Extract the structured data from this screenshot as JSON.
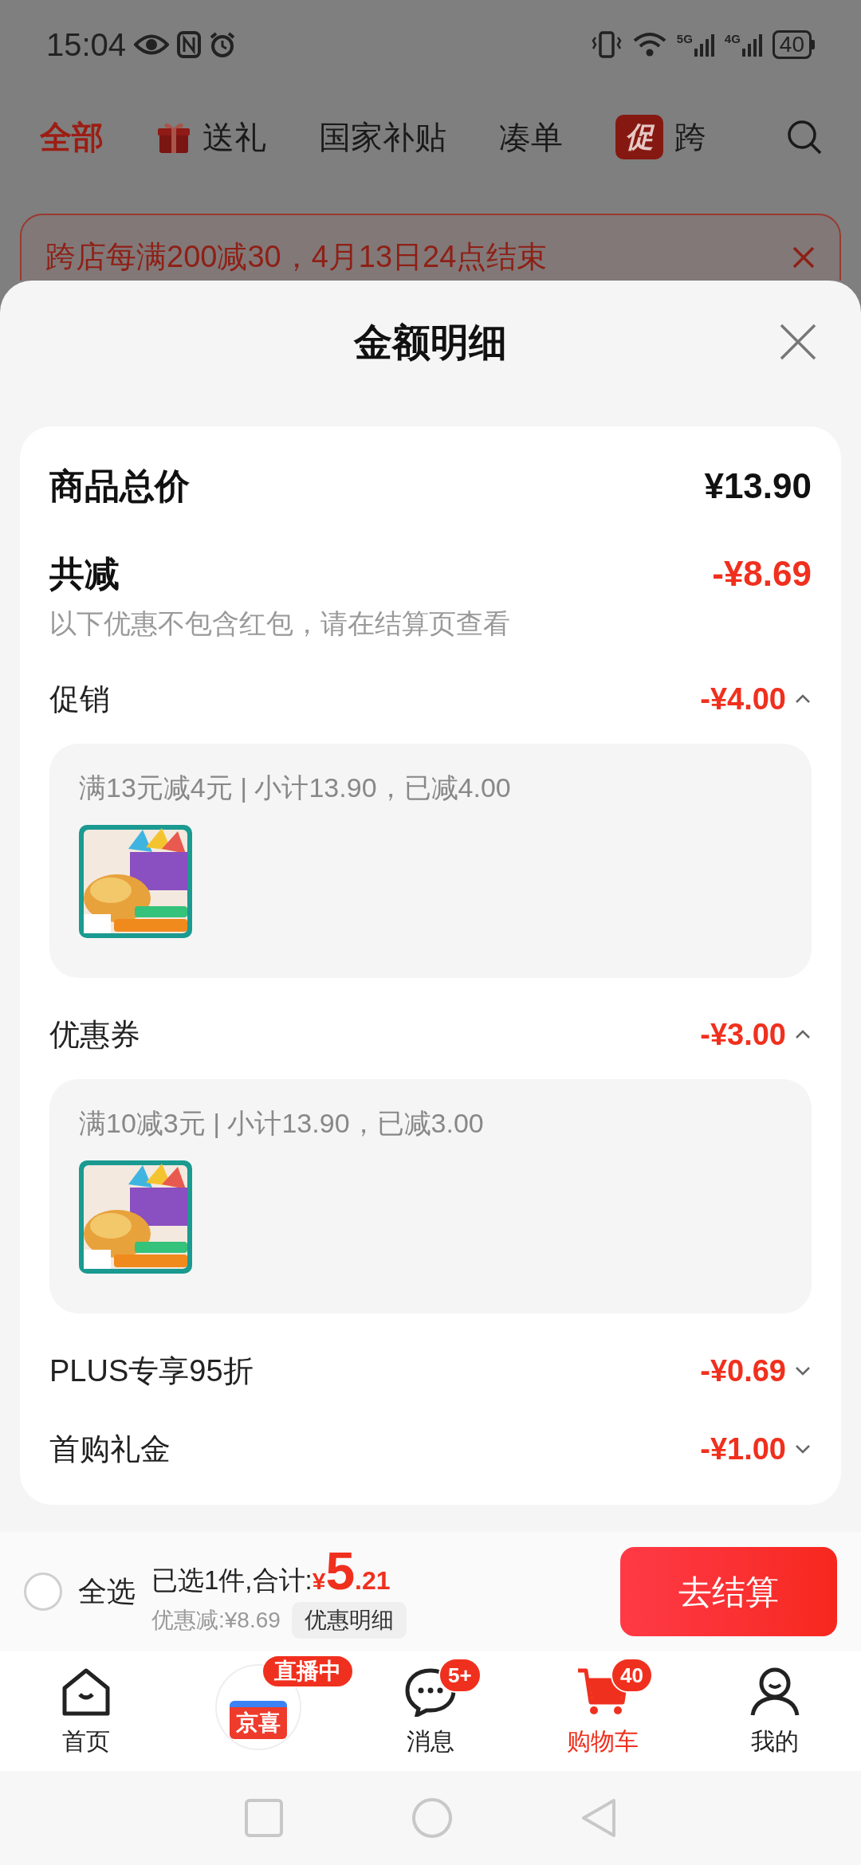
{
  "status_bar": {
    "time": "15:04",
    "network_1": "5G",
    "network_2": "4G",
    "battery": "40"
  },
  "tabs": [
    {
      "label": "全部",
      "selected": true,
      "kind": "text"
    },
    {
      "label": "送礼",
      "selected": false,
      "kind": "gift"
    },
    {
      "label": "国家补贴",
      "selected": false,
      "kind": "text"
    },
    {
      "label": "凑单",
      "selected": false,
      "kind": "text"
    },
    {
      "label": "跨",
      "selected": false,
      "kind": "promo",
      "badge": "促"
    }
  ],
  "banner": {
    "text": "跨店每满200减30，4月13日24点结束"
  },
  "sheet": {
    "title": "金额明细",
    "total": {
      "label": "商品总价",
      "value": "¥13.90"
    },
    "discount": {
      "label": "共减",
      "value": "-¥8.69",
      "note": "以下优惠不包含红包，请在结算页查看"
    },
    "sections": [
      {
        "label": "促销",
        "value": "-¥4.00",
        "expanded": true,
        "detail": "满13元减4元 | 小计13.90，已减4.00"
      },
      {
        "label": "优惠券",
        "value": "-¥3.00",
        "expanded": true,
        "detail": "满10减3元 | 小计13.90，已减3.00"
      },
      {
        "label": "PLUS专享95折",
        "value": "-¥0.69",
        "expanded": false
      },
      {
        "label": "首购礼金",
        "value": "-¥1.00",
        "expanded": false
      }
    ]
  },
  "checkout_bar": {
    "select_all": {
      "label": "全选",
      "checked": false
    },
    "summary": "已选1件,合计:",
    "currency": "¥",
    "amount_integer": "5",
    "amount_decimal": ".21",
    "saving": "优惠减:¥8.69",
    "detail_button": "优惠明细",
    "checkout_button": "去结算"
  },
  "bottom_nav": [
    {
      "kind": "home",
      "label": "首页",
      "selected": false
    },
    {
      "kind": "live",
      "logo": "京喜",
      "badge": "直播中",
      "selected": false
    },
    {
      "kind": "message",
      "label": "消息",
      "badge": "5+",
      "selected": false
    },
    {
      "kind": "cart",
      "label": "购物车",
      "badge": "40",
      "selected": true
    },
    {
      "kind": "profile",
      "label": "我的",
      "selected": false
    }
  ]
}
